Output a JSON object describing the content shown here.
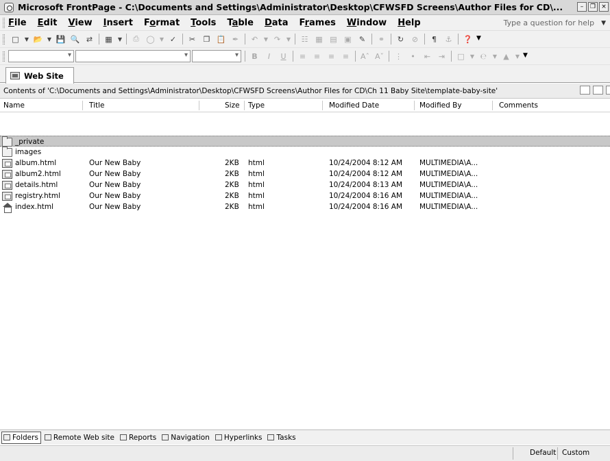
{
  "window": {
    "title": "Microsoft FrontPage - C:\\Documents and Settings\\Administrator\\Desktop\\CFWSFD Screens\\Author Files for CD\\...",
    "controls": [
      "minimize",
      "restore",
      "close"
    ]
  },
  "menu": {
    "items": [
      {
        "label": "File",
        "mnemonic": "F"
      },
      {
        "label": "Edit",
        "mnemonic": "E"
      },
      {
        "label": "View",
        "mnemonic": "V"
      },
      {
        "label": "Insert",
        "mnemonic": "I"
      },
      {
        "label": "Format",
        "mnemonic": "o"
      },
      {
        "label": "Tools",
        "mnemonic": "T"
      },
      {
        "label": "Table",
        "mnemonic": "a"
      },
      {
        "label": "Data",
        "mnemonic": "D"
      },
      {
        "label": "Frames",
        "mnemonic": "r"
      },
      {
        "label": "Window",
        "mnemonic": "W"
      },
      {
        "label": "Help",
        "mnemonic": "H"
      }
    ],
    "help_placeholder": "Type a question for help"
  },
  "formatting": {
    "bold": "B",
    "italic": "I",
    "underline": "U"
  },
  "tab": {
    "label": "Web Site"
  },
  "contents": {
    "path": "Contents of 'C:\\Documents and Settings\\Administrator\\Desktop\\CFWSFD Screens\\Author Files for CD\\Ch 11 Baby Site\\template-baby-site'"
  },
  "columns": {
    "name": "Name",
    "title": "Title",
    "size": "Size",
    "type": "Type",
    "modified_date": "Modified Date",
    "modified_by": "Modified By",
    "comments": "Comments"
  },
  "files": [
    {
      "icon": "folder-icon",
      "name": "_private",
      "title": "",
      "size": "",
      "type": "",
      "date": "",
      "by": "",
      "selected": true
    },
    {
      "icon": "folder-icon",
      "name": "images",
      "title": "",
      "size": "",
      "type": "",
      "date": "",
      "by": "",
      "selected": false
    },
    {
      "icon": "html-file-icon",
      "name": "album.html",
      "title": "Our New Baby",
      "size": "2KB",
      "type": "html",
      "date": "10/24/2004 8:12 AM",
      "by": "MULTIMEDIA\\A...",
      "selected": false
    },
    {
      "icon": "html-file-icon",
      "name": "album2.html",
      "title": "Our New Baby",
      "size": "2KB",
      "type": "html",
      "date": "10/24/2004 8:12 AM",
      "by": "MULTIMEDIA\\A...",
      "selected": false
    },
    {
      "icon": "html-file-icon",
      "name": "details.html",
      "title": "Our New Baby",
      "size": "2KB",
      "type": "html",
      "date": "10/24/2004 8:13 AM",
      "by": "MULTIMEDIA\\A...",
      "selected": false
    },
    {
      "icon": "html-file-icon",
      "name": "registry.html",
      "title": "Our New Baby",
      "size": "2KB",
      "type": "html",
      "date": "10/24/2004 8:16 AM",
      "by": "MULTIMEDIA\\A...",
      "selected": false
    },
    {
      "icon": "home-page-icon",
      "name": "index.html",
      "title": "Our New Baby",
      "size": "2KB",
      "type": "html",
      "date": "10/24/2004 8:16 AM",
      "by": "MULTIMEDIA\\A...",
      "selected": false
    }
  ],
  "views": [
    {
      "label": "Folders",
      "icon": "folders-view-icon",
      "active": true
    },
    {
      "label": "Remote Web site",
      "icon": "remote-site-icon",
      "active": false
    },
    {
      "label": "Reports",
      "icon": "reports-icon",
      "active": false
    },
    {
      "label": "Navigation",
      "icon": "navigation-icon",
      "active": false
    },
    {
      "label": "Hyperlinks",
      "icon": "hyperlinks-icon",
      "active": false
    },
    {
      "label": "Tasks",
      "icon": "tasks-icon",
      "active": false
    }
  ],
  "status": {
    "left": "Default",
    "right": "Custom"
  }
}
